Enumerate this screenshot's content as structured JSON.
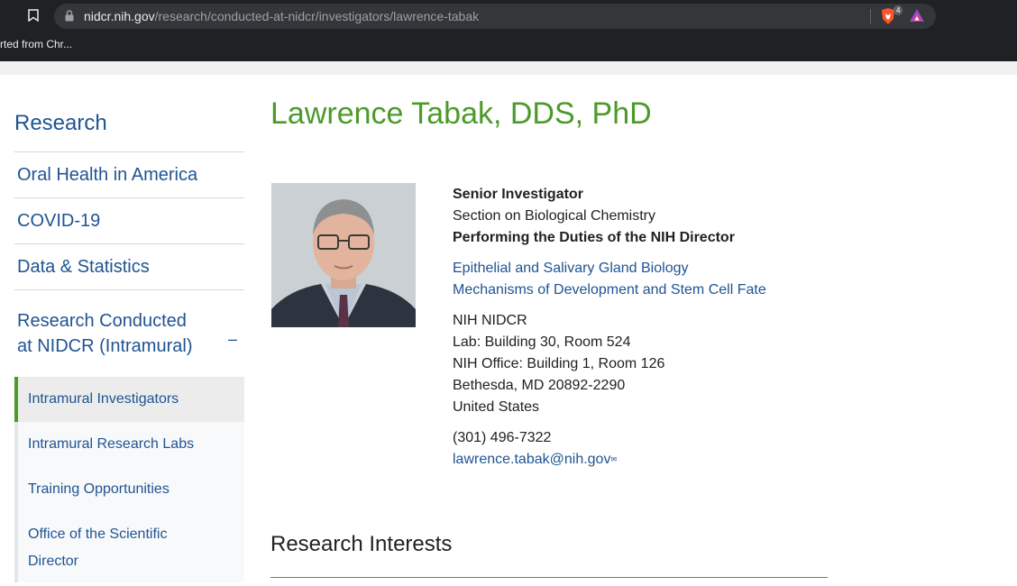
{
  "browser": {
    "url_host": "nidcr.nih.gov",
    "url_path": "/research/conducted-at-nidcr/investigators/lawrence-tabak",
    "brave_shield_count": "4",
    "bookmarks_bar_text": "rted from Chr..."
  },
  "sidebar": {
    "title": "Research",
    "items": [
      {
        "label": "Oral Health in America"
      },
      {
        "label": "COVID-19"
      },
      {
        "label": "Data & Statistics"
      }
    ],
    "expanded": {
      "label_line1": "Research Conducted",
      "label_line2": "at NIDCR (Intramural)",
      "toggle": "–"
    },
    "sub_items": [
      {
        "label": "Intramural Investigators"
      },
      {
        "label": "Intramural Research Labs"
      },
      {
        "label": "Training Opportunities"
      },
      {
        "label_line1": "Office of the Scientific",
        "label_line2": "Director"
      }
    ]
  },
  "profile": {
    "name": "Lawrence Tabak, DDS, PhD",
    "role": "Senior Investigator",
    "section": "Section on Biological Chemistry",
    "duties": "Performing the Duties of the NIH Director",
    "research_links": [
      "Epithelial and Salivary Gland Biology",
      "Mechanisms of Development and Stem Cell Fate"
    ],
    "address": [
      "NIH NIDCR",
      "Lab: Building 30, Room 524",
      "NIH Office: Building 1, Room 126",
      "Bethesda, MD 20892-2290",
      "United States"
    ],
    "phone": "(301) 496-7322",
    "email": "lawrence.tabak@nih.gov"
  },
  "sections": {
    "research_interests": "Research Interests"
  },
  "colors": {
    "accent_green": "#4c9a2a",
    "link_blue": "#205493",
    "chrome_dark": "#202124"
  }
}
